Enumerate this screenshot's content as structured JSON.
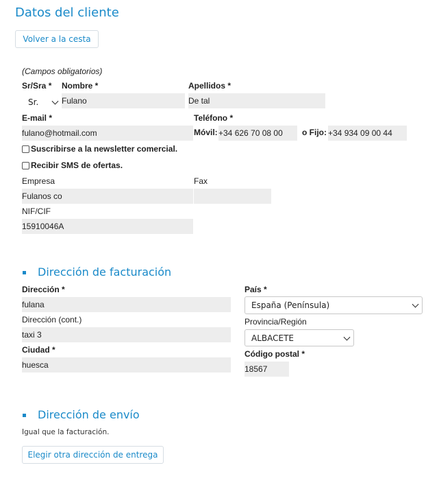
{
  "page": {
    "title": "Datos del cliente",
    "back_button": "Volver a la cesta",
    "required_note": "(Campos obligatorios)"
  },
  "customer": {
    "salutation_label": "Sr/Sra *",
    "salutation_value": "Sr.",
    "name_label": "Nombre *",
    "name_value": "Fulano",
    "surname_label": "Apellidos *",
    "surname_value": "De tal",
    "email_label": "E-mail *",
    "email_value": "fulano@hotmail.com",
    "phone_label": "Teléfono *",
    "mobile_label": "Móvil:",
    "mobile_value": "+34 626 70 08 00",
    "landline_label": "o Fijo:",
    "landline_value": "+34 934 09 00 44",
    "newsletter_label": "Suscribirse a la newsletter comercial.",
    "newsletter_checked": false,
    "sms_label": "Recibir SMS de ofertas.",
    "sms_checked": false,
    "company_label": "Empresa",
    "company_value": "Fulanos co",
    "fax_label": "Fax",
    "nif_label": "NIF/CIF",
    "nif_value": "15910046A"
  },
  "billing": {
    "title": "Dirección de facturación",
    "address_label": "Dirección *",
    "address_value": "fulana",
    "address2_label": "Dirección (cont.)",
    "address2_value": "taxi 3",
    "city_label": "Ciudad *",
    "city_value": "huesca",
    "country_label": "País *",
    "country_value": "España (Península)",
    "province_label": "Provincia/Región",
    "province_value": "ALBACETE",
    "postal_label": "Código postal *",
    "postal_value": "18567"
  },
  "shipping": {
    "title": "Dirección de envío",
    "note": "Igual que la facturación.",
    "other_button": "Elegir otra dirección de entrega"
  },
  "colors": {
    "accent": "#1a8ac9",
    "field_bg": "#ededed"
  }
}
